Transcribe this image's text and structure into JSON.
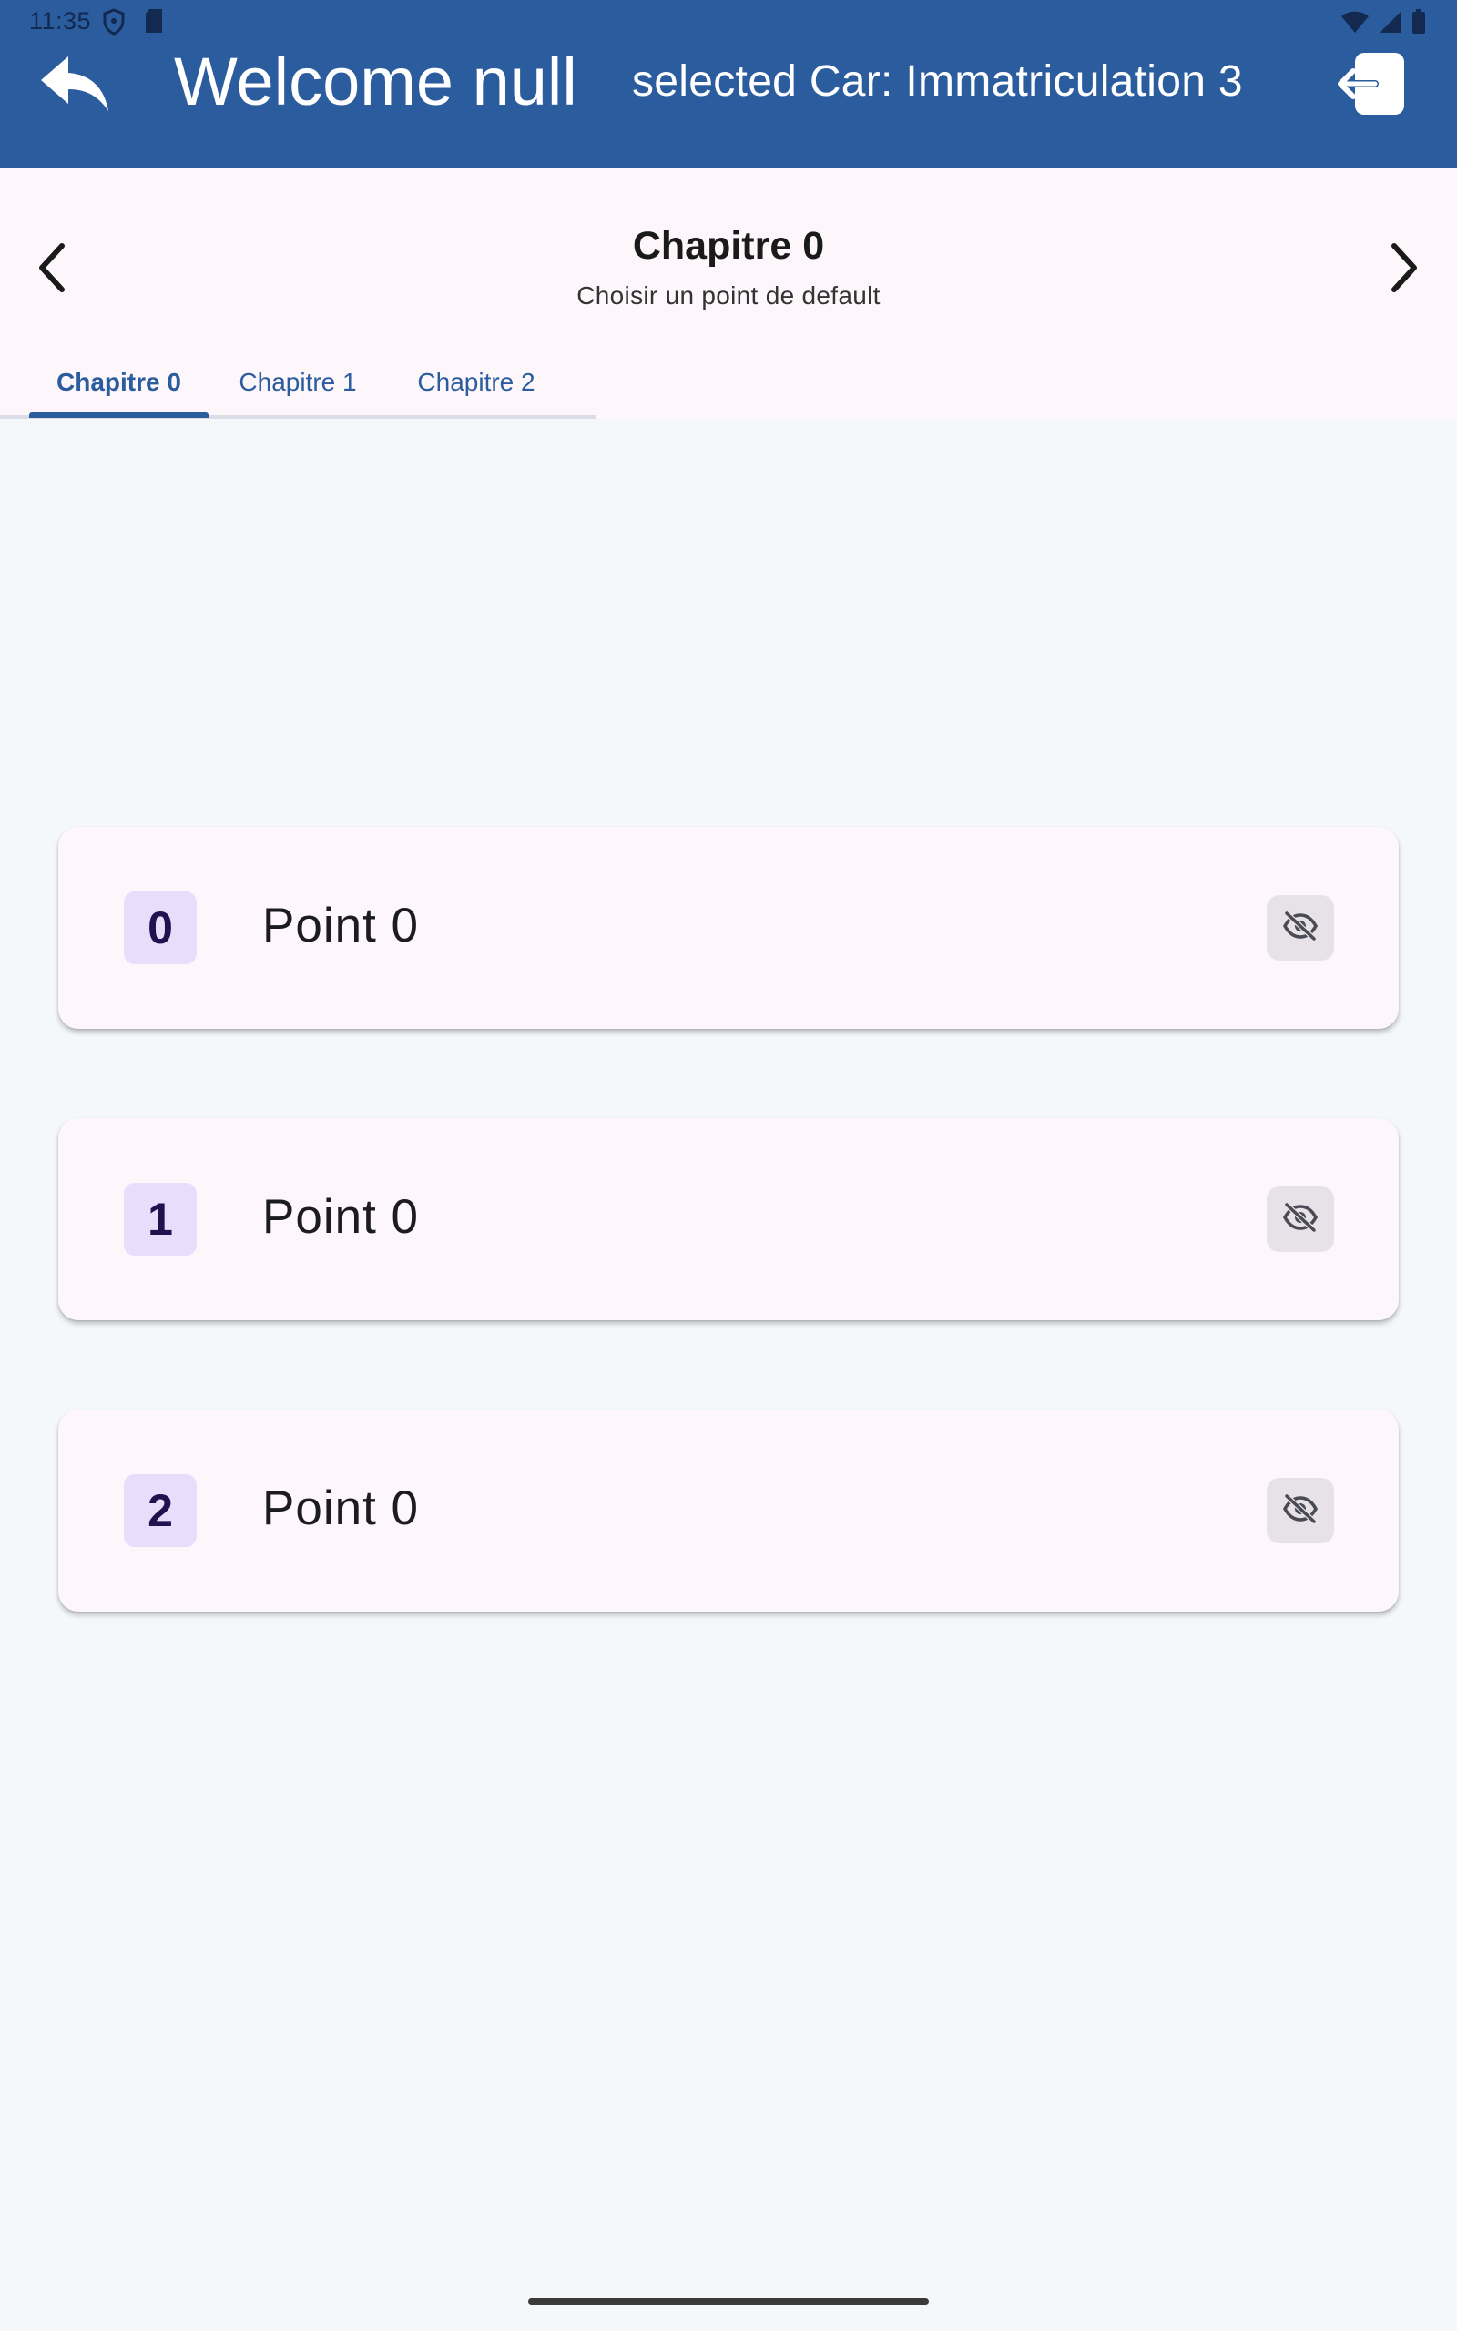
{
  "status_bar": {
    "time": "11:35",
    "icons_left": [
      "shield-icon",
      "sd-card-icon"
    ],
    "icons_right": [
      "wifi-icon",
      "signal-icon",
      "battery-icon"
    ]
  },
  "app_bar": {
    "back_icon": "reply-arrow-icon",
    "welcome": "Welcome null",
    "selected_car": "selected Car: Immatriculation 3",
    "logout_icon": "logout-icon",
    "color": "#2b5c9e"
  },
  "chapter_header": {
    "title": "Chapitre 0",
    "subtitle": "Choisir un point de default",
    "prev_icon": "chevron-left-icon",
    "next_icon": "chevron-right-icon"
  },
  "tabs": [
    {
      "label": "Chapitre 0",
      "active": true
    },
    {
      "label": "Chapitre 1",
      "active": false
    },
    {
      "label": "Chapitre 2",
      "active": false
    }
  ],
  "points": [
    {
      "index": "0",
      "label": "Point 0",
      "visibility_icon": "eye-off-icon"
    },
    {
      "index": "1",
      "label": "Point 0",
      "visibility_icon": "eye-off-icon"
    },
    {
      "index": "2",
      "label": "Point 0",
      "visibility_icon": "eye-off-icon"
    }
  ],
  "colors": {
    "primary": "#2b5c9e",
    "surface": "#fdf7fc",
    "background": "#f4f8fb",
    "index_badge": "#e9ddfb"
  }
}
